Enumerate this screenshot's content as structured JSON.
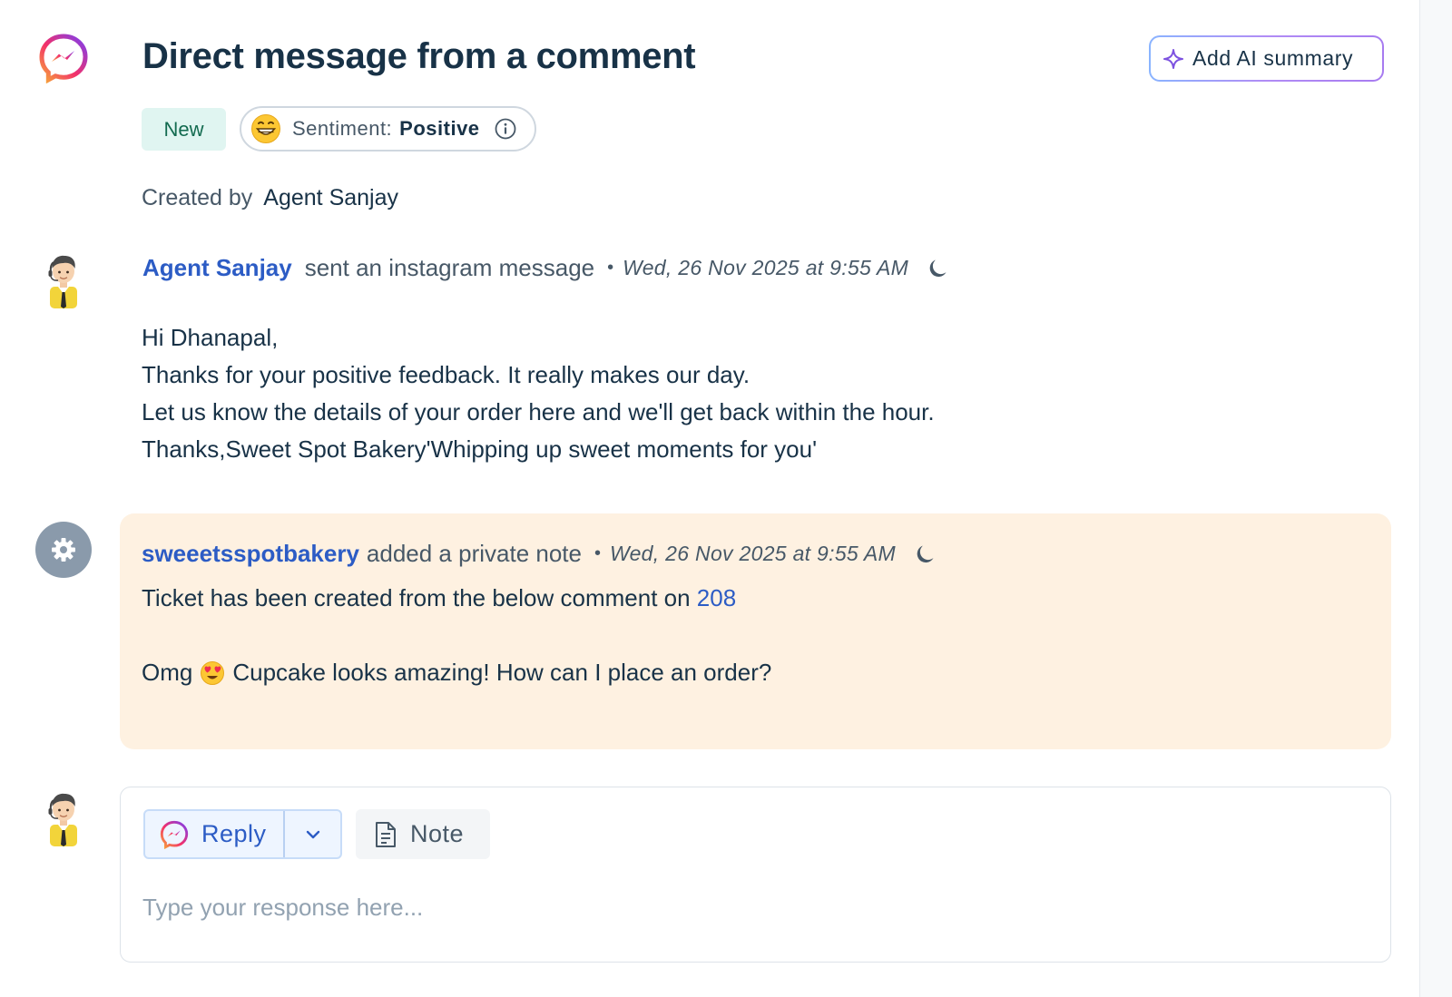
{
  "ticket": {
    "title": "Direct message from a comment",
    "ai_summary_label": "Add AI summary",
    "status_badge": "New",
    "sentiment": {
      "label": "Sentiment:",
      "value": "Positive"
    },
    "created_by_label": "Created by",
    "created_by_name": "Agent Sanjay"
  },
  "conversation": [
    {
      "author": "Agent Sanjay",
      "action": "sent an instagram message",
      "separator": "•",
      "timestamp": "Wed, 26 Nov 2025 at 9:55 AM",
      "body_lines": [
        "Hi Dhanapal,",
        "Thanks for your positive feedback. It really makes our day.",
        "Let us know the details of your order here and we'll get back within the hour.",
        "Thanks,Sweet Spot Bakery'Whipping up sweet moments for you'"
      ]
    },
    {
      "author": "sweeetsspotbakery",
      "action": "added a private note",
      "separator": "•",
      "timestamp": "Wed, 26 Nov 2025 at 9:55 AM",
      "line1_text": "Ticket has been created from the below comment on ",
      "line1_link": "208",
      "line2_before": "Omg",
      "line2_after": "Cupcake looks amazing! How can I place an order?"
    }
  ],
  "editor": {
    "reply_label": "Reply",
    "note_label": "Note",
    "placeholder": "Type your response here..."
  },
  "colors": {
    "link_blue": "#2c5cc5",
    "note_background": "#fef1e1",
    "new_badge_bg": "#e0f5f1",
    "new_badge_text": "#136b50"
  },
  "icons": {
    "channel": "messenger-icon",
    "ai": "sparkle-icon",
    "sentiment": "grinning-face-icon",
    "info": "info-icon",
    "snooze": "moon-icon",
    "system": "gear-icon",
    "note": "document-icon",
    "caret": "chevron-down-icon"
  }
}
